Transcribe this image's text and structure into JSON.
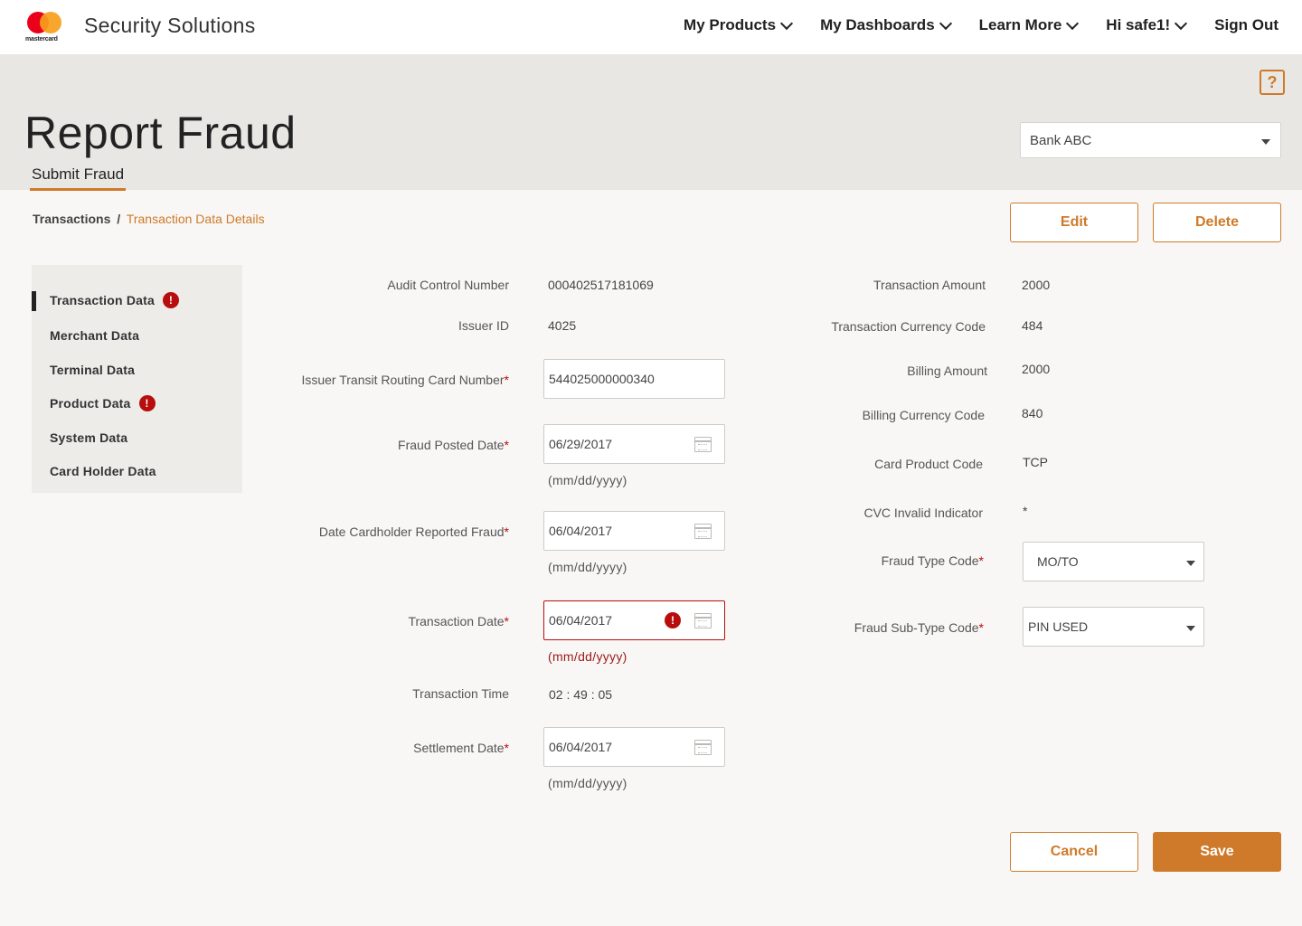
{
  "header": {
    "brand_word": "mastercard",
    "app_title": "Security Solutions",
    "nav": [
      {
        "label": "My Products"
      },
      {
        "label": "My Dashboards"
      },
      {
        "label": "Learn More"
      },
      {
        "label": "Hi safe1!"
      },
      {
        "label": "Sign Out"
      }
    ]
  },
  "hero": {
    "help_glyph": "?",
    "title": "Report Fraud",
    "subtab": "Submit Fraud",
    "bank_select": "Bank ABC"
  },
  "breadcrumb": {
    "parent": "Transactions",
    "separator": "/",
    "current": "Transaction Data Details"
  },
  "actions": {
    "edit": "Edit",
    "delete": "Delete",
    "cancel": "Cancel",
    "save": "Save"
  },
  "sidebar": {
    "items": [
      {
        "label": "Transaction Data",
        "error": true,
        "active": true
      },
      {
        "label": "Merchant Data"
      },
      {
        "label": "Terminal Data"
      },
      {
        "label": "Product Data",
        "error": true
      },
      {
        "label": "System Data"
      },
      {
        "label": "Card Holder Data"
      }
    ],
    "error_glyph": "!"
  },
  "form_left": {
    "audit_control_number": {
      "label": "Audit  Control Number",
      "value": "000402517181069"
    },
    "issuer_id": {
      "label": "Issuer ID",
      "value": "4025"
    },
    "issuer_transit_routing": {
      "label": "Issuer Transit Routing Card Number",
      "required": "*",
      "value": "544025000000340"
    },
    "fraud_posted_date": {
      "label": "Fraud Posted Date",
      "required": "*",
      "value": "06/29/2017",
      "hint": "(mm/dd/yyyy)"
    },
    "date_cardholder_reported": {
      "label": "Date Cardholder Reported Fraud",
      "required": "*",
      "value": "06/04/2017",
      "hint": "(mm/dd/yyyy)"
    },
    "transaction_date": {
      "label": "Transaction Date",
      "required": "*",
      "value": "06/04/2017",
      "hint": "(mm/dd/yyyy)",
      "error": true
    },
    "transaction_time": {
      "label": "Transaction Time",
      "value": "02 : 49 : 05"
    },
    "settlement_date": {
      "label": "Settlement Date",
      "required": "*",
      "value": "06/04/2017",
      "hint": "(mm/dd/yyyy)"
    }
  },
  "form_right": {
    "transaction_amount": {
      "label": "Transaction Amount",
      "value": "2000"
    },
    "transaction_currency_code": {
      "label": "Transaction Currency Code",
      "value": "484"
    },
    "billing_amount": {
      "label": "Billing Amount",
      "value": "2000"
    },
    "billing_currency_code": {
      "label": "Billing Currency Code",
      "value": "840"
    },
    "card_product_code": {
      "label": "Card Product Code",
      "value": "TCP"
    },
    "cvc_invalid_indicator": {
      "label": "CVC Invalid Indicator",
      "value": "*"
    },
    "fraud_type_code": {
      "label": "Fraud Type Code",
      "required": "*",
      "value": "MO/TO"
    },
    "fraud_sub_type_code": {
      "label": "Fraud Sub-Type Code",
      "required": "*",
      "value": "PIN USED"
    }
  },
  "colors": {
    "accent": "#cf7a2a",
    "error": "#b80d0d",
    "hero_bg": "#e9e7e4",
    "page_bg": "#f8f7f5"
  }
}
